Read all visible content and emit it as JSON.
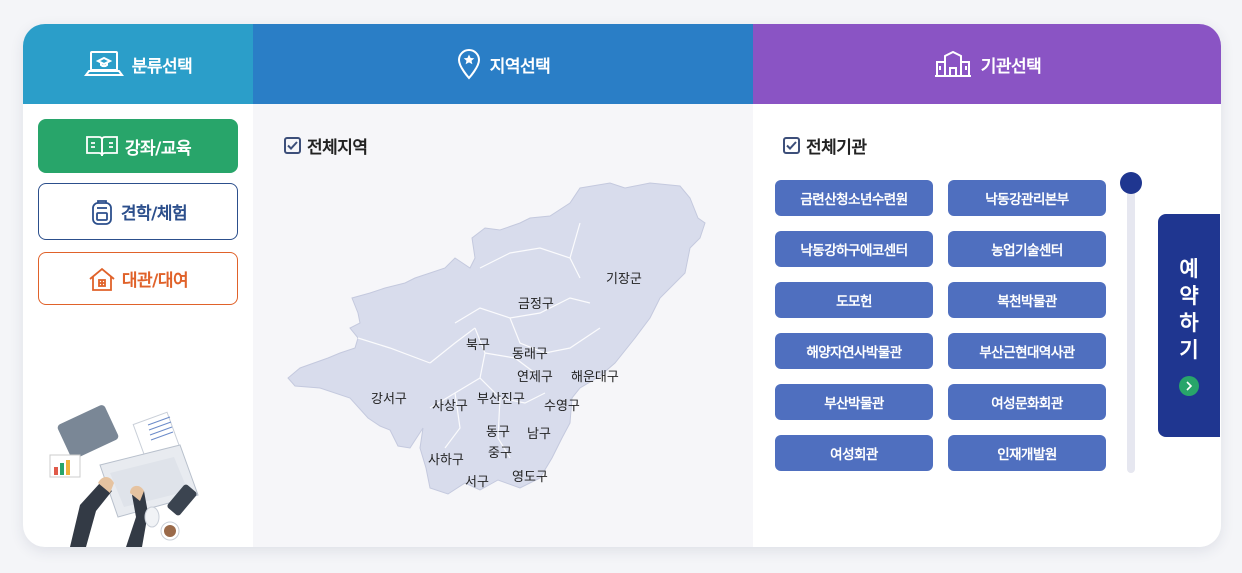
{
  "header": {
    "category_label": "분류선택",
    "region_label": "지역선택",
    "institution_label": "기관선택"
  },
  "categories": [
    {
      "label": "강좌/교육",
      "icon": "book-icon"
    },
    {
      "label": "견학/체험",
      "icon": "backpack-icon"
    },
    {
      "label": "대관/대여",
      "icon": "house-icon"
    }
  ],
  "region": {
    "all_label": "전체지역",
    "districts": [
      "기장군",
      "금정구",
      "북구",
      "동래구",
      "연제구",
      "해운대구",
      "강서구",
      "사상구",
      "부산진구",
      "수영구",
      "동구",
      "남구",
      "사하구",
      "중구",
      "서구",
      "영도구"
    ]
  },
  "institution": {
    "all_label": "전체기관",
    "items": [
      "금련산청소년수련원",
      "낙동강관리본부",
      "낙동강하구에코센터",
      "농업기술센터",
      "도모헌",
      "복천박물관",
      "해양자연사박물관",
      "부산근현대역사관",
      "부산박물관",
      "여성문화회관",
      "여성회관",
      "인재개발원"
    ]
  },
  "reserve": {
    "chars": [
      "예",
      "약",
      "하",
      "기"
    ]
  },
  "colors": {
    "category_header": "#2b9ec9",
    "region_header": "#2a7ec6",
    "institution_header": "#8a54c4",
    "active_category": "#28a56a",
    "institution_button": "#4f6fbf",
    "reserve_tab": "#1f3690"
  }
}
